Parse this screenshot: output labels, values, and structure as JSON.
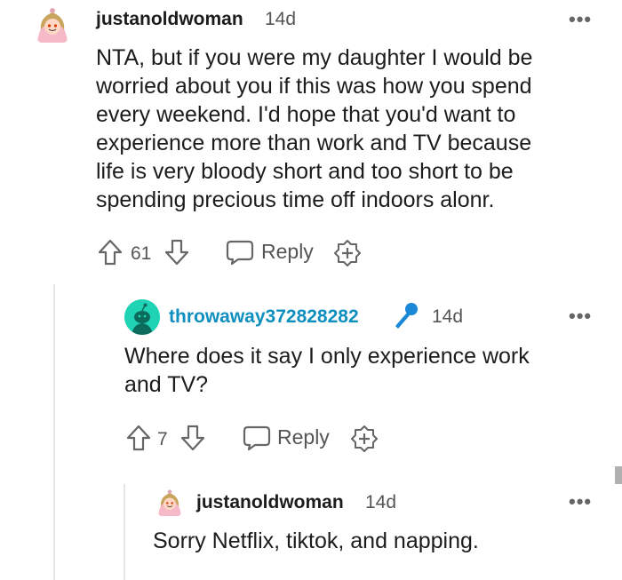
{
  "comments": [
    {
      "username": "justanoldwoman",
      "age": "14d",
      "text_lines": [
        "NTA, but if you were my daughter I would be",
        "worried about you if this was how you spend",
        "every weekend. I'd hope that you'd want to",
        "experience more than work and TV because",
        "life is very bloody short and too short to be",
        "spending precious time off indoors alonr."
      ],
      "votes": "61",
      "reply_label": "Reply",
      "avatar_icon": "grandma-avatar-icon"
    },
    {
      "username": "throwaway372828282",
      "age": "14d",
      "text_lines": [
        "Where does it say I only experience work",
        "and TV?"
      ],
      "votes": "7",
      "reply_label": "Reply",
      "avatar_icon": "snoo-avatar-icon",
      "badge_icon": "microphone-icon"
    },
    {
      "username": "justanoldwoman",
      "age": "14d",
      "text_lines": [
        "Sorry Netflix, tiktok, and napping."
      ],
      "avatar_icon": "grandma-avatar-icon"
    }
  ],
  "colors": {
    "op_username": "#1c1c1c",
    "reply_username": "#0f8fbf",
    "microphone": "#1a88d6",
    "meta": "#555555",
    "thread_line": "#e6e6e6"
  },
  "more_label": "•••"
}
